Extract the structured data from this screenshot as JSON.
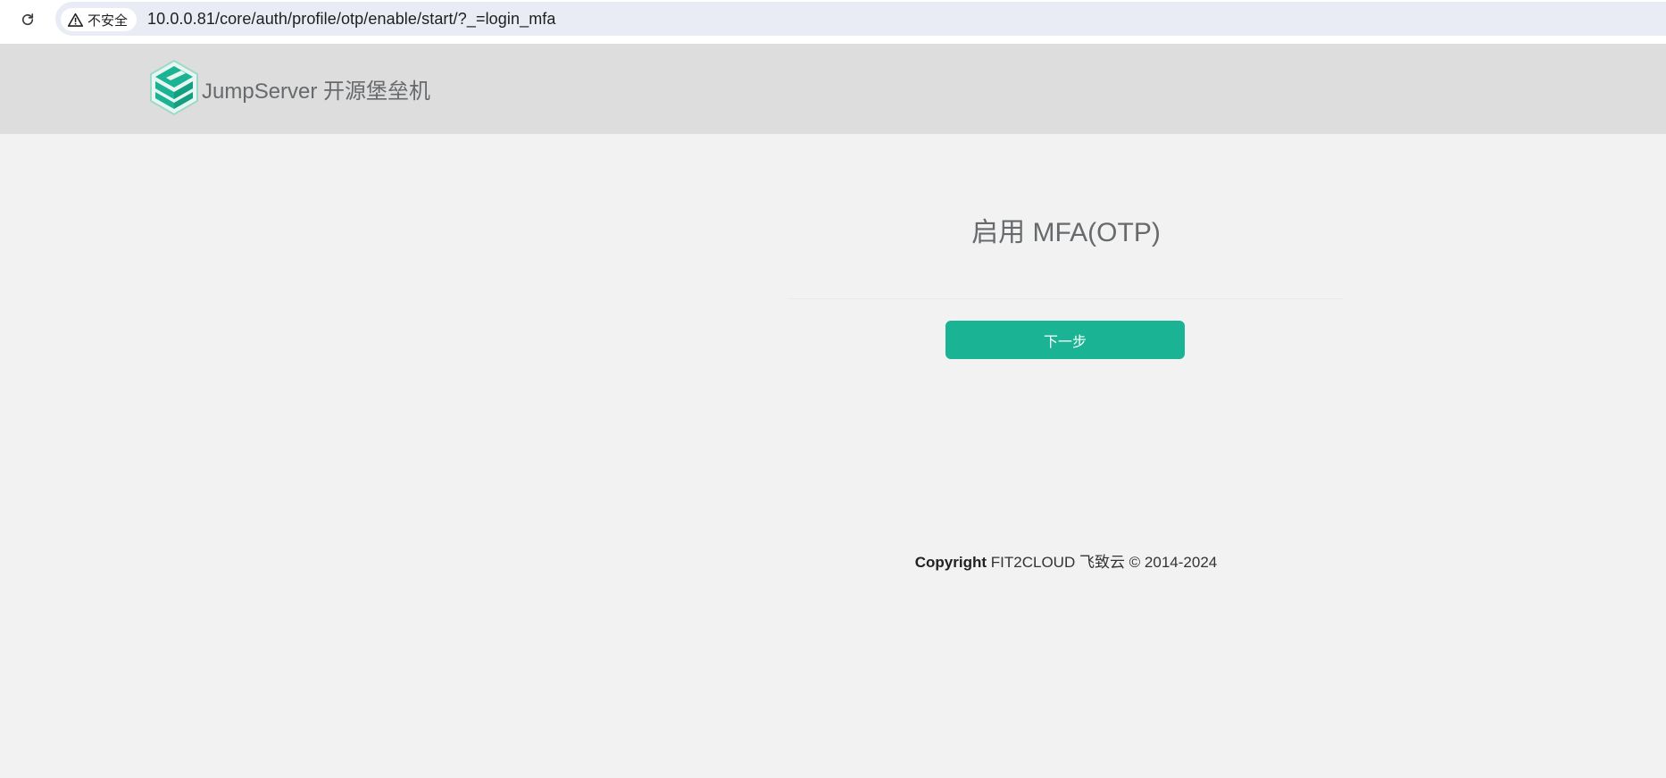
{
  "browser": {
    "security_label": "不安全",
    "url": "10.0.0.81/core/auth/profile/otp/enable/start/?_=login_mfa",
    "icons": {
      "reload": "reload-icon",
      "security": "warning-triangle-icon"
    }
  },
  "header": {
    "brand_name": "JumpServer 开源堡垒机",
    "logo_icon": "jumpserver-logo",
    "background": "#dddddd"
  },
  "main": {
    "title": "启用 MFA(OTP)",
    "next_button_label": "下一步",
    "accent_color": "#1ab394"
  },
  "footer": {
    "copyright_label": "Copyright",
    "copyright_text": "FIT2CLOUD 飞致云 © 2014-2024"
  }
}
